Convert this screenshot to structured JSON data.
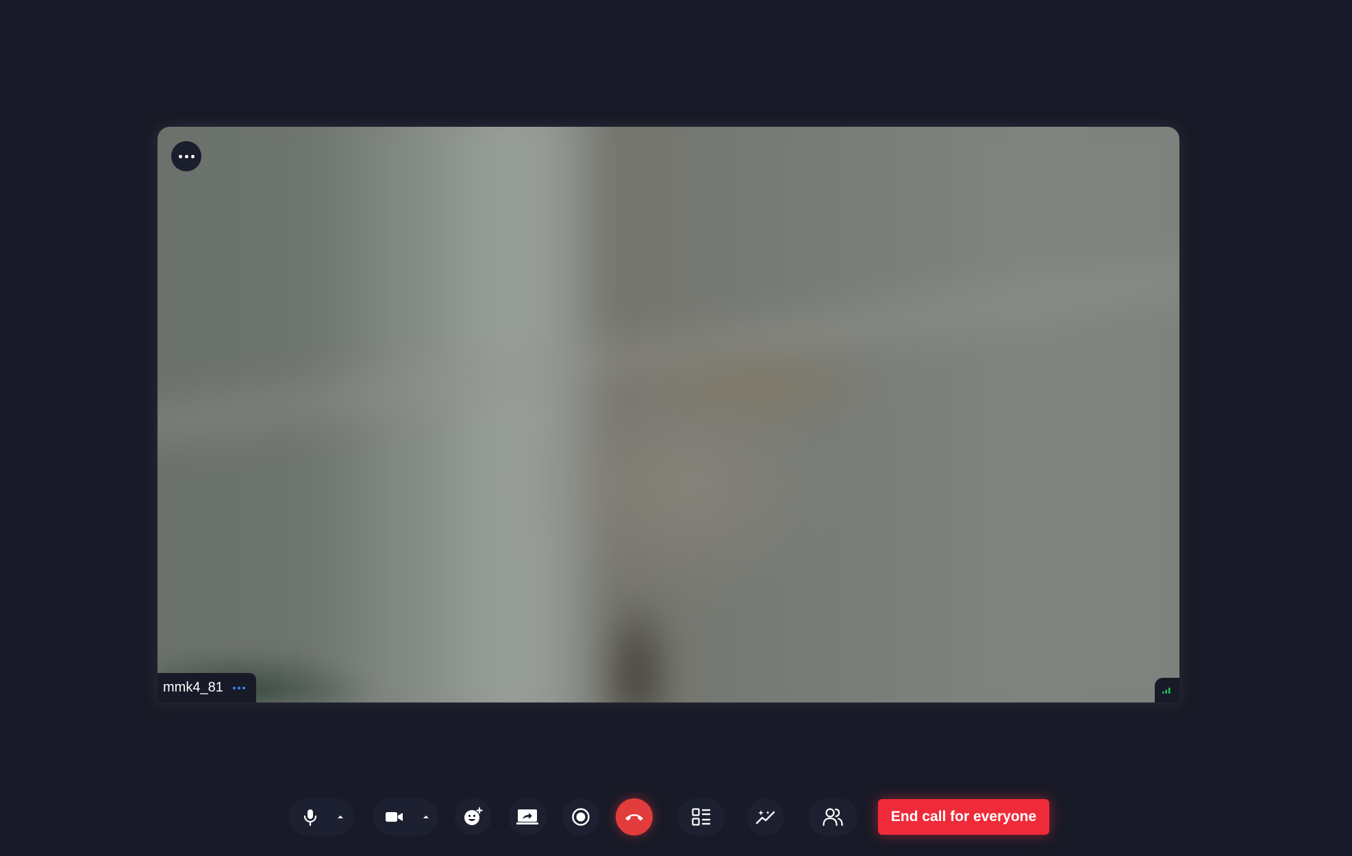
{
  "video_tile": {
    "participant_name": "mmk4_81",
    "tile_menu_icon": "more-horizontal-icon",
    "name_options_icon": "more-horizontal-icon",
    "signal_icon": "signal-bars-icon",
    "signal_color": "#22c55e",
    "video_state": "blurred-camera-feed"
  },
  "toolbar": {
    "microphone": {
      "icon": "microphone-icon",
      "menu_icon": "caret-up-icon"
    },
    "camera": {
      "icon": "video-camera-icon",
      "menu_icon": "caret-up-icon"
    },
    "reactions": {
      "icon": "emoji-add-icon"
    },
    "screen_share": {
      "icon": "screen-share-icon"
    },
    "record": {
      "icon": "record-icon"
    },
    "leave_call": {
      "icon": "phone-hangup-icon",
      "color": "#e33c3c"
    },
    "layout": {
      "icon": "layout-list-icon"
    },
    "effects": {
      "icon": "sparkle-chart-icon"
    },
    "participants": {
      "icon": "people-icon"
    },
    "end_call_label": "End call for everyone",
    "end_call_color": "#ef2b3a"
  },
  "colors": {
    "background": "#181a27",
    "button_bg": "#1d2030",
    "accent_blue": "#3b82f6"
  }
}
